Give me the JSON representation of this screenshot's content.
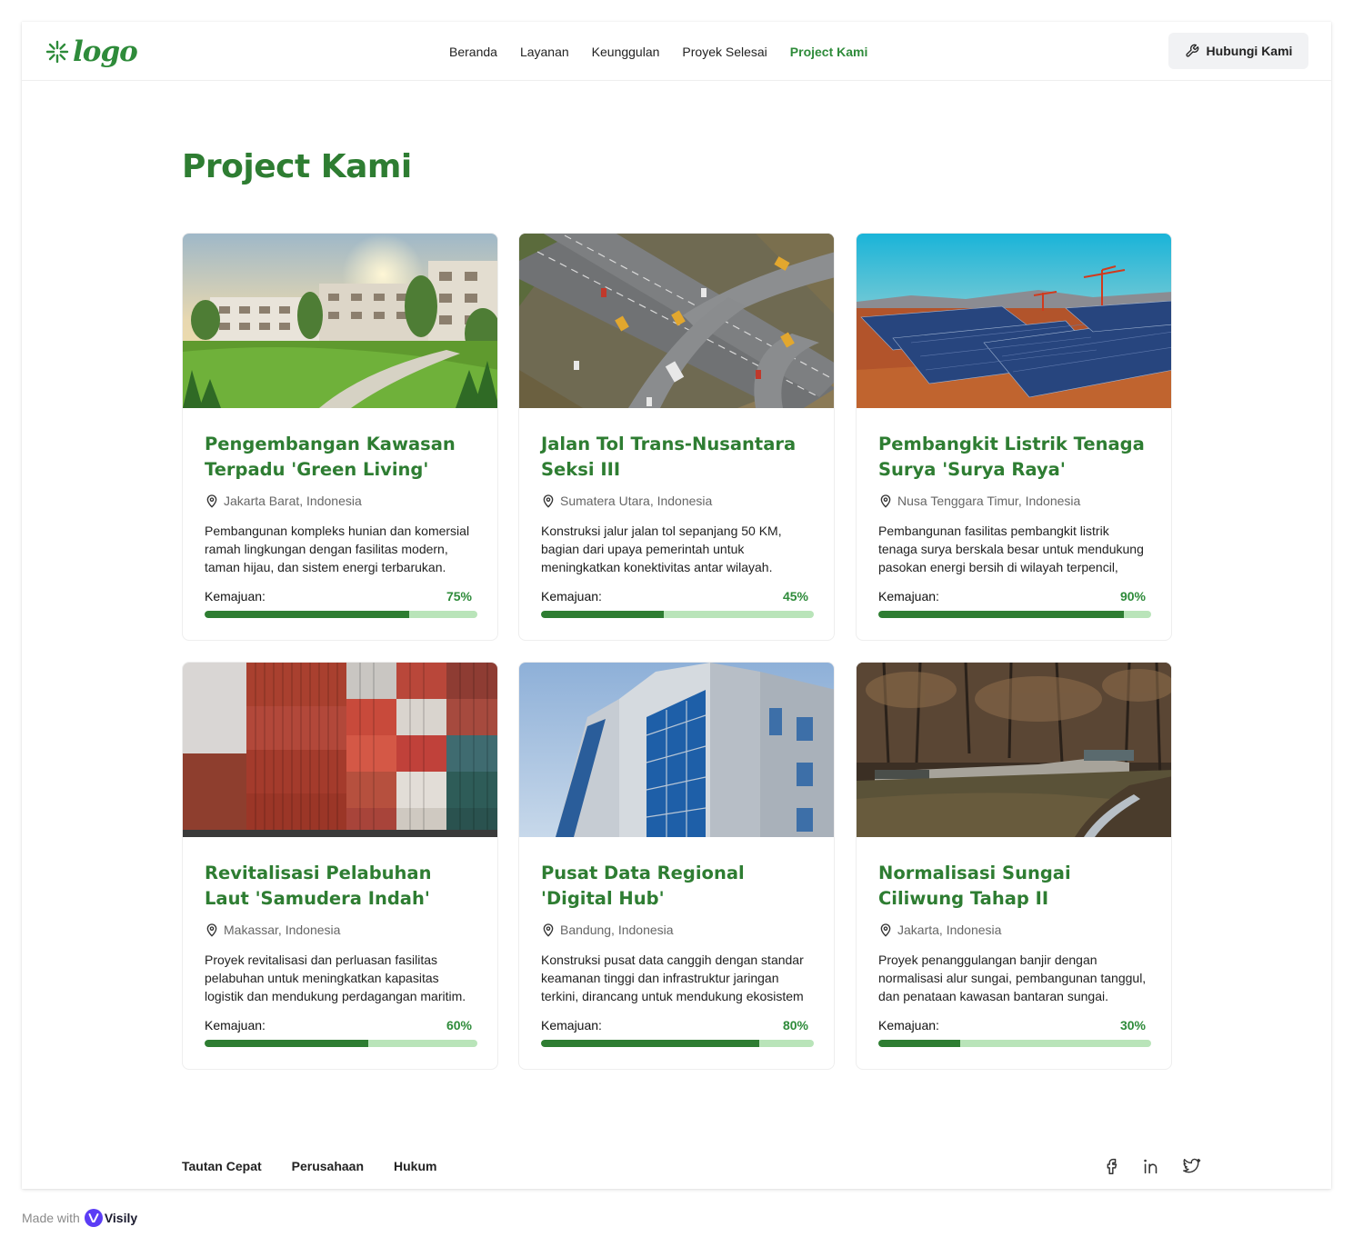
{
  "header": {
    "logo_text": "logo",
    "nav": [
      {
        "label": "Beranda",
        "active": false
      },
      {
        "label": "Layanan",
        "active": false
      },
      {
        "label": "Keunggulan",
        "active": false
      },
      {
        "label": "Proyek Selesai",
        "active": false
      },
      {
        "label": "Project Kami",
        "active": true
      }
    ],
    "contact_button": "Hubungi Kami"
  },
  "page": {
    "title": "Project Kami"
  },
  "progress_label": "Kemajuan:",
  "projects": [
    {
      "title": "Pengembangan Kawasan Terpadu 'Green Living'",
      "location": "Jakarta Barat, Indonesia",
      "description": "Pembangunan kompleks hunian dan komersial ramah lingkungan dengan fasilitas modern, taman hijau, dan sistem energi terbarukan.",
      "progress": 75,
      "progress_text": "75%",
      "image": "green-living-residential-photo"
    },
    {
      "title": "Jalan Tol Trans-Nusantara Seksi III",
      "location": "Sumatera Utara, Indonesia",
      "description": "Konstruksi jalur jalan tol sepanjang 50 KM, bagian dari upaya pemerintah untuk meningkatkan konektivitas antar wilayah.",
      "progress": 45,
      "progress_text": "45%",
      "image": "highway-interchange-photo"
    },
    {
      "title": "Pembangkit Listrik Tenaga Surya 'Surya Raya'",
      "location": "Nusa Tenggara Timur, Indonesia",
      "description": "Pembangunan fasilitas pembangkit listrik tenaga surya berskala besar untuk mendukung pasokan energi bersih di wilayah terpencil,",
      "progress": 90,
      "progress_text": "90%",
      "image": "solar-farm-photo"
    },
    {
      "title": "Revitalisasi Pelabuhan Laut 'Samudera Indah'",
      "location": "Makassar, Indonesia",
      "description": "Proyek revitalisasi dan perluasan fasilitas pelabuhan untuk meningkatkan kapasitas logistik dan mendukung perdagangan maritim.",
      "progress": 60,
      "progress_text": "60%",
      "image": "shipping-containers-photo"
    },
    {
      "title": "Pusat Data Regional 'Digital Hub'",
      "location": "Bandung, Indonesia",
      "description": "Konstruksi pusat data canggih dengan standar keamanan tinggi dan infrastruktur jaringan terkini, dirancang untuk mendukung ekosistem",
      "progress": 80,
      "progress_text": "80%",
      "image": "glass-building-photo"
    },
    {
      "title": "Normalisasi Sungai Ciliwung Tahap II",
      "location": "Jakarta, Indonesia",
      "description": "Proyek penanggulangan banjir dengan normalisasi alur sungai, pembangunan tanggul, dan penataan kawasan bantaran sungai.",
      "progress": 30,
      "progress_text": "30%",
      "image": "river-forest-photo"
    }
  ],
  "footer": {
    "links": [
      "Tautan Cepat",
      "Perusahaan",
      "Hukum"
    ],
    "socials": [
      "facebook-icon",
      "linkedin-icon",
      "twitter-icon"
    ]
  },
  "badge": {
    "prefix": "Made with",
    "brand": "Visily"
  },
  "colors": {
    "brand_green": "#2e7d32",
    "progress_track": "#b9e4b9",
    "button_bg": "#f1f2f4"
  }
}
